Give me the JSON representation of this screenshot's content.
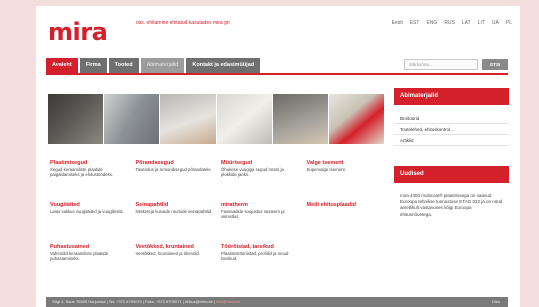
{
  "header": {
    "logo": "mira",
    "tagline": "oss. ehitamine ehitatud kasutades mira gri",
    "languages": [
      "Eesti",
      "EST",
      "ENG",
      "RUS",
      "LAT",
      "LIT",
      "UA",
      "PL"
    ]
  },
  "nav": {
    "items": [
      "Avaleht",
      "Firma",
      "Tooted",
      "Abimaterjalid",
      "Kontakt ja edasimüüjad"
    ],
    "search_placeholder": "Märksõna...",
    "search_button": "OTSI"
  },
  "products": [
    {
      "title": "Plaatimisegud",
      "desc": "Segud keraamiliste plaatide paigaldamiseks ja ehitustöödeks."
    },
    {
      "title": "Põrandasegud",
      "desc": "Tasandus ja remondisegud põrandatele."
    },
    {
      "title": "Müürisegud",
      "desc": "Õhukese vuugiga segud müüri ja plokkide jaoks."
    },
    {
      "title": "Valge tsement",
      "desc": "Supervalge tsement."
    },
    {
      "title": "Vuugitäited",
      "desc": "Laias valikus vuugitäited ja vuugiliimid."
    },
    {
      "title": "Seinapahtlid",
      "desc": "Niisketeja kuivade ruumide seinapahtlid."
    },
    {
      "title": "miratherm",
      "desc": "Fassaadide soojustus süsteem ja viimistlus."
    },
    {
      "title": "Medi ehitusplaadid",
      "desc": ""
    },
    {
      "title": "Puhastusained",
      "desc": "Vahendid keraamiliste plaatide puhastamiseks."
    },
    {
      "title": "Veetõkked, kruntained",
      "desc": "Veetõkked, kruntained ja tihendid."
    },
    {
      "title": "Töörõistad, tarvikud",
      "desc": "Plaatimistööriistad, profiilid ja muud tarvikud."
    },
    {
      "title": "",
      "desc": ""
    }
  ],
  "sidebar": {
    "materials_title": "Abimaterjalid",
    "materials_links": [
      "Brošüürid",
      "Tootelehed, ehituskontrol...",
      "Artiklid"
    ],
    "news_title": "Uudised",
    "news_text": "mira 4400 multicoat® plaatimisega on saanud Euroopa tehnilise tunnustuse ETAG 022 ja on nüüd ametlikult vastavuses kõigi Euroopa ehitusnõuetega."
  },
  "footer": {
    "text": "Sõgi 4, Saue 76505 Harjumaa | Tel: +372 6709070 | Faks: +372 6709071 | ehitus@mira.ee |",
    "email": "info@mira.ee",
    "up": "Üles"
  }
}
